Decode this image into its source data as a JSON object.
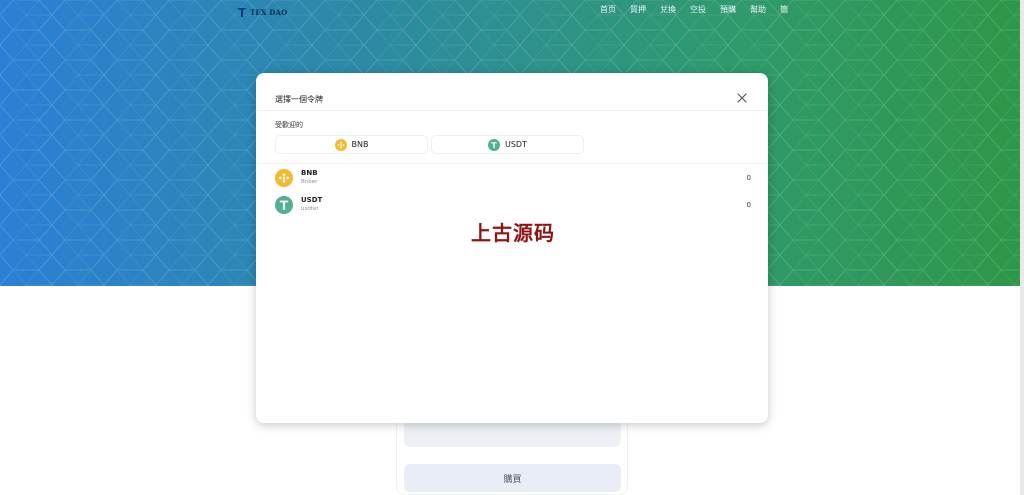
{
  "header": {
    "logo_text": "TEX DAO",
    "nav": [
      "首页",
      "質押",
      "兌換",
      "空投",
      "預購",
      "幫助",
      "簡"
    ]
  },
  "modal": {
    "title": "選擇一個令牌",
    "popular_label": "受歡迎的",
    "popular_tokens": [
      {
        "symbol": "BNB",
        "icon": "bnb-icon"
      },
      {
        "symbol": "USDT",
        "icon": "usdt-icon"
      }
    ],
    "tokens": [
      {
        "symbol": "BNB",
        "name": "Bnber",
        "balance": "0",
        "icon": "bnb-icon"
      },
      {
        "symbol": "USDT",
        "name": "usdter",
        "balance": "0",
        "icon": "usdt-icon"
      }
    ],
    "close_icon": "close-icon"
  },
  "watermark": "上古源码",
  "purchase": {
    "buy_label": "購買"
  },
  "colors": {
    "bnb": "#F3BA2F",
    "usdt": "#50AF95",
    "hero_start": "#2c7fd6",
    "hero_end": "#2f9748",
    "watermark": "#8f1515"
  }
}
